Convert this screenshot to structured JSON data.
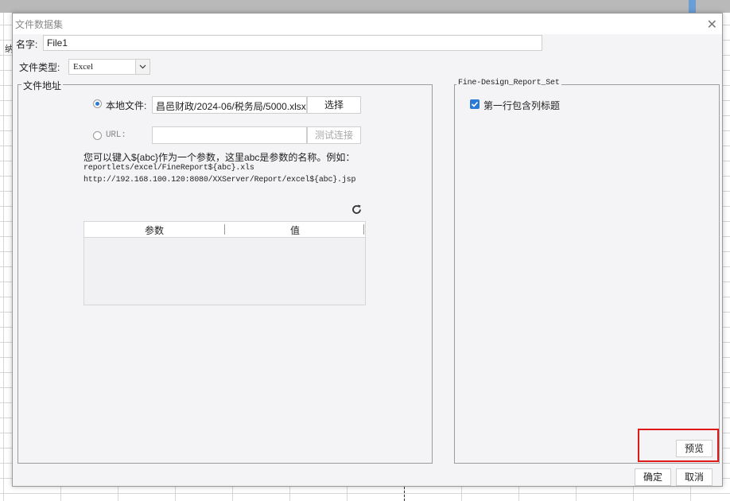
{
  "background": {
    "behind_label": "纳"
  },
  "dialog": {
    "title": "文件数据集",
    "name_label": "名字:",
    "name_value": "File1",
    "file_type_label": "文件类型:",
    "file_type_value": "Excel",
    "file_address_group": "文件地址",
    "local_file_label": "本地文件:",
    "local_file_path": "昌邑财政/2024-06/税务局/5000.xlsx",
    "choose_button": "选择",
    "url_label": "URL:",
    "url_value": "",
    "test_connection_button": "测试连接",
    "hint_line1": "您可以键入${abc}作为一个参数，这里abc是参数的名称。例如：",
    "hint_line2": "reportlets/excel/FineReport${abc}.xls",
    "hint_line3": "http://192.168.100.120:8080/XXServer/Report/excel${abc}.jsp",
    "param_table": {
      "columns": [
        "参数",
        "值"
      ],
      "rows": []
    },
    "settings_group": "Fine-Design_Report_Set",
    "first_row_header_label": "第一行包含列标题",
    "first_row_header_checked": true,
    "preview_button": "预览",
    "ok_button": "确定",
    "cancel_button": "取消"
  },
  "colors": {
    "accent": "#2b7bd6",
    "highlight": "#e01818"
  }
}
